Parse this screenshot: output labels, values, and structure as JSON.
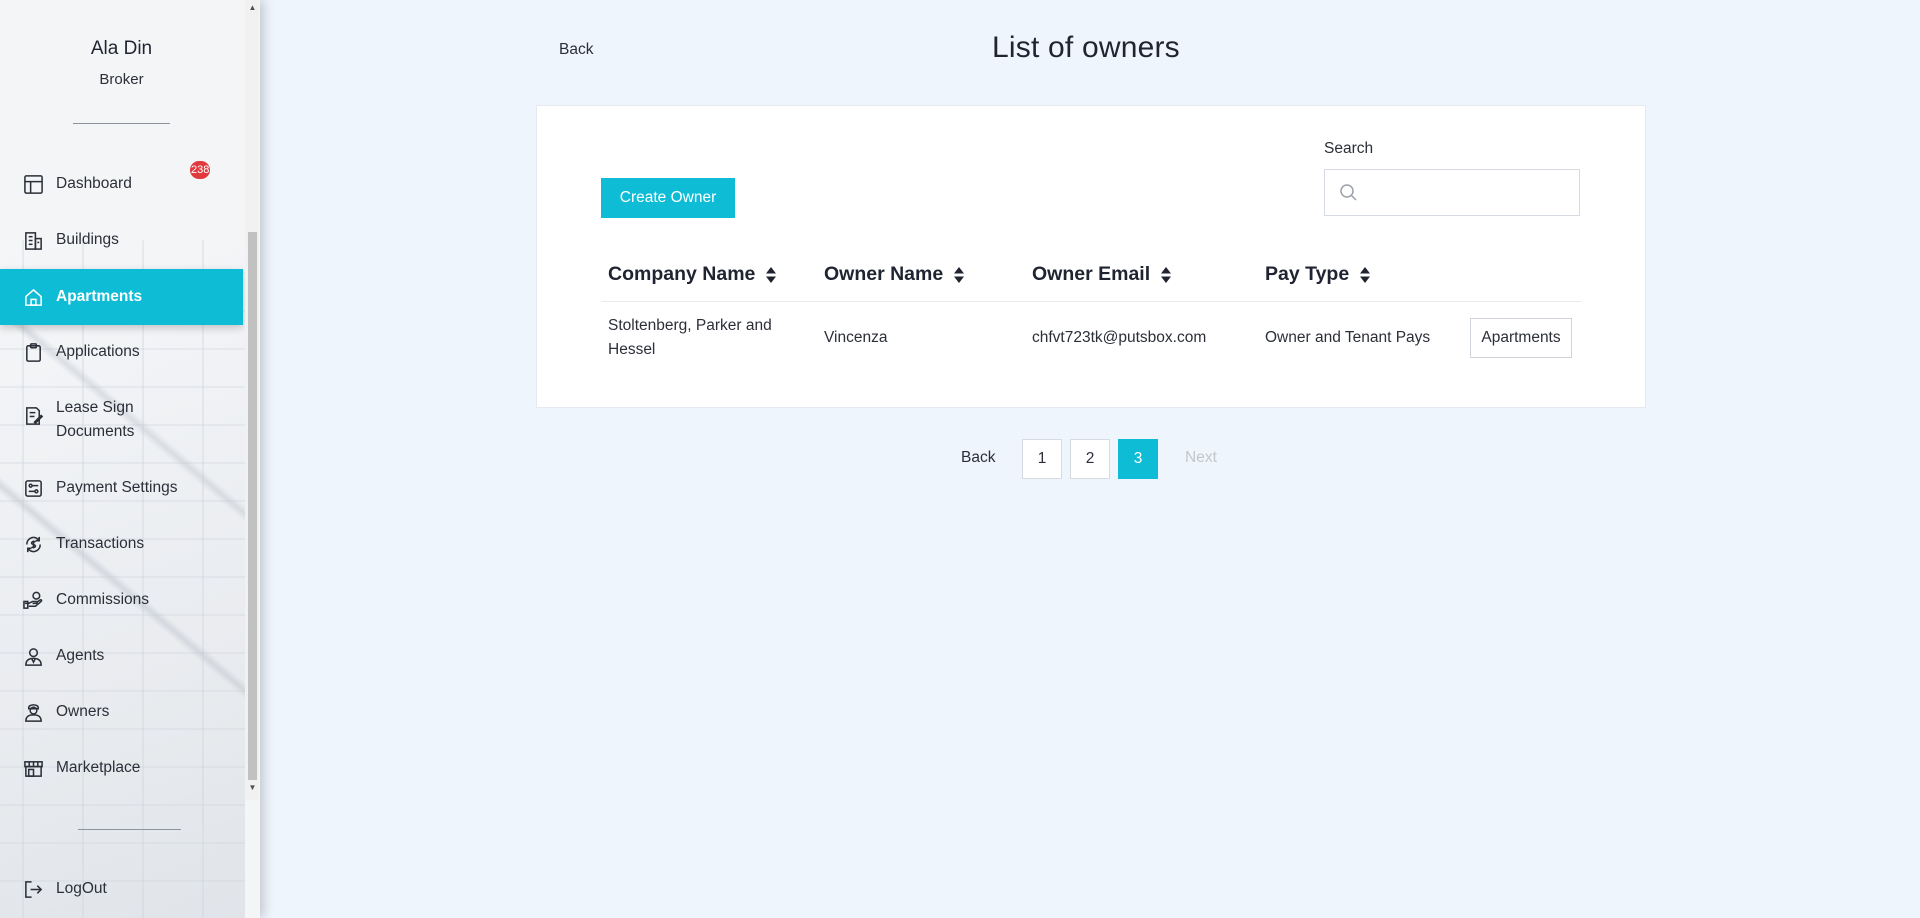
{
  "user": {
    "name": "Ala Din",
    "role": "Broker"
  },
  "nav": {
    "dashboard": {
      "label": "Dashboard",
      "badge": "238"
    },
    "buildings": {
      "label": "Buildings"
    },
    "apartments": {
      "label": "Apartments"
    },
    "applications": {
      "label": "Applications"
    },
    "lease": {
      "label": "Lease Sign Documents"
    },
    "payment": {
      "label": "Payment Settings"
    },
    "transactions": {
      "label": "Transactions"
    },
    "commissions": {
      "label": "Commissions"
    },
    "agents": {
      "label": "Agents"
    },
    "owners": {
      "label": "Owners"
    },
    "marketplace": {
      "label": "Marketplace"
    },
    "logout": {
      "label": "LogOut"
    }
  },
  "header": {
    "back": "Back",
    "title": "List of owners"
  },
  "toolbar": {
    "create": "Create Owner",
    "search_label": "Search",
    "search_value": ""
  },
  "table": {
    "headers": [
      "Company Name",
      "Owner Name",
      "Owner Email",
      "Pay Type"
    ],
    "rows": [
      {
        "company": "Stoltenberg, Parker and Hessel",
        "owner": "Vincenza",
        "email": "chfvt723tk@putsbox.com",
        "pay_type": "Owner and Tenant Pays",
        "action": "Apartments"
      }
    ]
  },
  "pagination": {
    "back": "Back",
    "pages": [
      "1",
      "2",
      "3"
    ],
    "current": "3",
    "next": "Next"
  },
  "colors": {
    "accent": "#0fbcd6",
    "badge": "#e03a3f",
    "background": "#eef5fc"
  }
}
